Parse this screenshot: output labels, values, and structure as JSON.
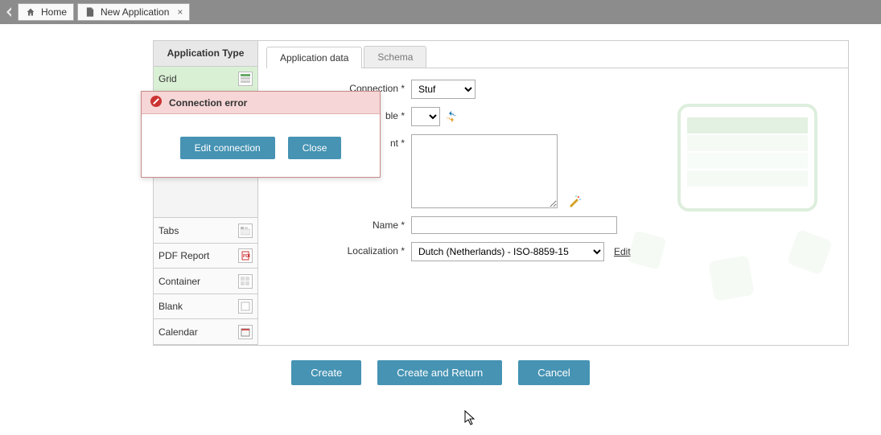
{
  "tabs": {
    "home": "Home",
    "newapp": "New Application"
  },
  "sidebar": {
    "header": "Application Type",
    "items": [
      {
        "label": "Grid"
      },
      {
        "label": "Tabs"
      },
      {
        "label": "PDF Report"
      },
      {
        "label": "Container"
      },
      {
        "label": "Blank"
      },
      {
        "label": "Calendar"
      }
    ]
  },
  "innerTabs": {
    "appdata": "Application data",
    "schema": "Schema"
  },
  "form": {
    "connection_label": "Connection *",
    "table_label": "ble *",
    "sql_label": "nt *",
    "name_label": "Name *",
    "localization_label": "Localization *",
    "connection_value": "Stuf",
    "localization_value": "Dutch (Netherlands) - ISO-8859-15",
    "edit_link": "Edit"
  },
  "buttons": {
    "create": "Create",
    "create_return": "Create and Return",
    "cancel": "Cancel"
  },
  "error": {
    "title": "Connection error",
    "edit_btn": "Edit connection",
    "close_btn": "Close"
  }
}
